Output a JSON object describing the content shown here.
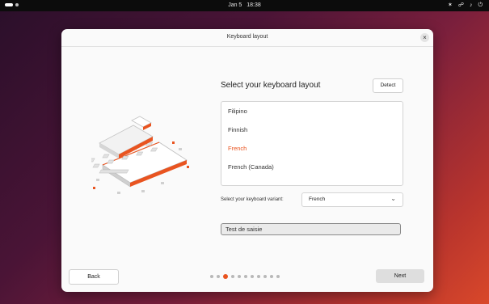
{
  "topbar": {
    "date": "Jan 5",
    "time": "18:38",
    "icons": [
      "accessibility-icon",
      "network-icon",
      "volume-icon",
      "power-icon"
    ]
  },
  "dialog": {
    "title": "Keyboard layout"
  },
  "main": {
    "heading": "Select your keyboard layout",
    "detect_label": "Detect",
    "layouts": [
      {
        "label": "Filipino",
        "selected": false
      },
      {
        "label": "Finnish",
        "selected": false
      },
      {
        "label": "French",
        "selected": true
      },
      {
        "label": "French (Canada)",
        "selected": false
      }
    ],
    "variant_label": "Select your keyboard variant:",
    "variant_value": "French",
    "test_value": "Test de saisie"
  },
  "footer": {
    "back_label": "Back",
    "next_label": "Next",
    "page_count": 11,
    "current_page": 3
  },
  "colors": {
    "accent": "#e95420",
    "dialog_bg": "#fafafa",
    "topbar_bg": "#0c0c0c"
  }
}
